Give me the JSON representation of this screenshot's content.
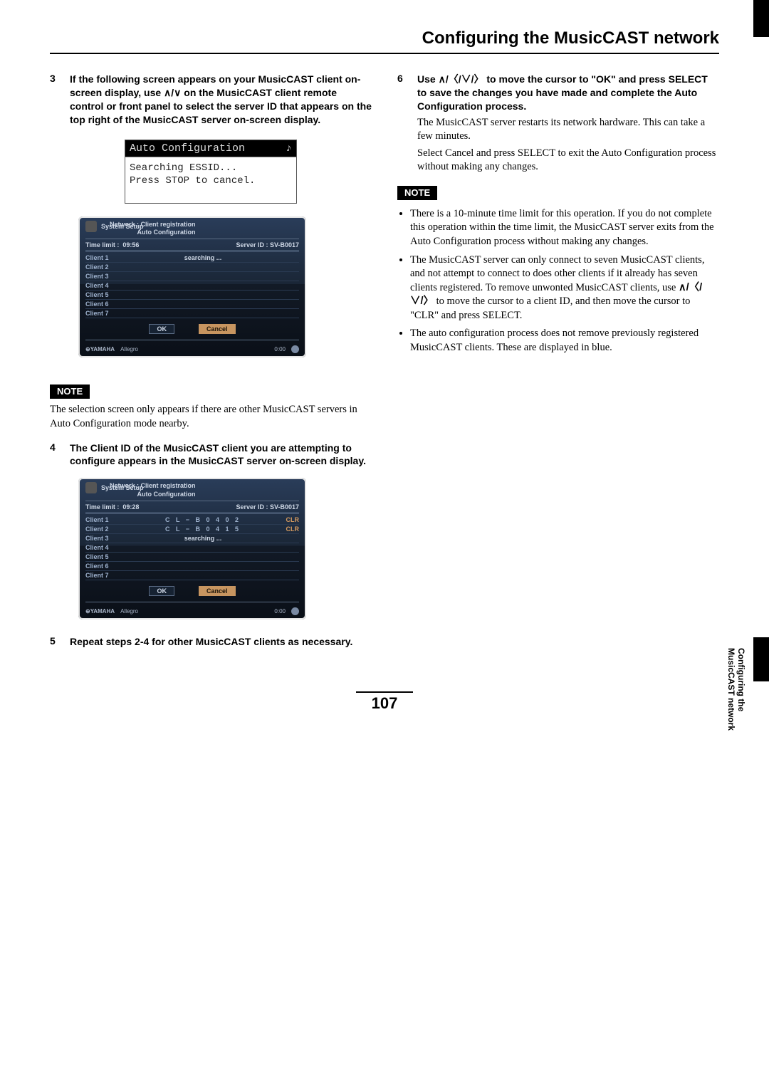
{
  "page_title": "Configuring the MusicCAST network",
  "side_tab": "Configuring the MusicCAST network",
  "page_number": "107",
  "steps": {
    "s3": {
      "num": "3",
      "bold_a": "If the following screen appears on your MusicCAST client on-screen display, use ",
      "bold_b": " on the MusicCAST client remote control or front panel to select the server ID that appears on the top right of the MusicCAST server on-screen display.",
      "arrows": "∧/∨"
    },
    "s4": {
      "num": "4",
      "text": "The Client ID of the MusicCAST client you are attempting to configure appears in the MusicCAST server on-screen display."
    },
    "s5": {
      "num": "5",
      "text": "Repeat steps 2-4 for other MusicCAST clients as necessary."
    },
    "s6": {
      "num": "6",
      "bold_a": "Use ",
      "arrows": "∧/〈/∨/〉",
      "bold_b": " to move the cursor to \"OK\" and press SELECT to save the changes you have made and complete the Auto Configuration process.",
      "after1": "The MusicCAST server restarts its network hardware. This can take a few minutes.",
      "after2": "Select Cancel and press SELECT to exit the Auto Configuration process without making any changes."
    }
  },
  "lcd": {
    "title": "Auto Configuration",
    "icon": "♪",
    "line1": "Searching ESSID...",
    "line2": "Press STOP to cancel."
  },
  "tv1": {
    "brand_line": "System Setup",
    "heading1": "Network : Client registration",
    "heading2": "Auto Configuration",
    "time_label": "Time limit :",
    "time_value": "09:56",
    "server_label": "Server ID : SV-B0017",
    "rows": [
      {
        "label": "Client 1",
        "mid": "searching ...",
        "clr": ""
      },
      {
        "label": "Client 2",
        "mid": "",
        "clr": ""
      },
      {
        "label": "Client 3",
        "mid": "",
        "clr": ""
      },
      {
        "label": "Client 4",
        "mid": "",
        "clr": ""
      },
      {
        "label": "Client 5",
        "mid": "",
        "clr": ""
      },
      {
        "label": "Client 6",
        "mid": "",
        "clr": ""
      },
      {
        "label": "Client 7",
        "mid": "",
        "clr": ""
      }
    ],
    "ok": "OK",
    "cancel": "Cancel",
    "footer_brand": "⊕YAMAHA",
    "footer_name": "Allegro",
    "footer_time": "0:00"
  },
  "tv2": {
    "brand_line": "System Setup",
    "heading1": "Network : Client registration",
    "heading2": "Auto Configuration",
    "time_label": "Time limit :",
    "time_value": "09:28",
    "server_label": "Server ID : SV-B0017",
    "rows": [
      {
        "label": "Client 1",
        "mid": "C L − B 0 4 0 2",
        "clr": "CLR"
      },
      {
        "label": "Client 2",
        "mid": "C L − B 0 4 1 5",
        "clr": "CLR"
      },
      {
        "label": "Client 3",
        "mid": "searching ...",
        "clr": ""
      },
      {
        "label": "Client 4",
        "mid": "",
        "clr": ""
      },
      {
        "label": "Client 5",
        "mid": "",
        "clr": ""
      },
      {
        "label": "Client 6",
        "mid": "",
        "clr": ""
      },
      {
        "label": "Client 7",
        "mid": "",
        "clr": ""
      }
    ],
    "ok": "OK",
    "cancel": "Cancel",
    "footer_brand": "⊕YAMAHA",
    "footer_name": "Allegro",
    "footer_time": "0:00"
  },
  "note_left": {
    "label": "NOTE",
    "text": "The selection screen only appears if there are other MusicCAST servers in Auto Configuration mode nearby."
  },
  "note_right": {
    "label": "NOTE",
    "b1": "There is a 10-minute time limit for this operation. If you do not complete this operation within the time limit, the MusicCAST server exits from the Auto Configuration process without making any changes.",
    "b2a": "The MusicCAST server can only connect to seven MusicCAST clients, and not attempt to connect to does other clients if it already has seven clients registered. To remove unwonted MusicCAST clients, use ",
    "b2_arrows": "∧/〈/∨/〉",
    "b2b": " to move the cursor to a client ID, and then move the cursor to \"CLR\" and press SELECT.",
    "b3": "The auto configuration process does not remove previously registered MusicCAST clients. These are displayed in blue."
  }
}
